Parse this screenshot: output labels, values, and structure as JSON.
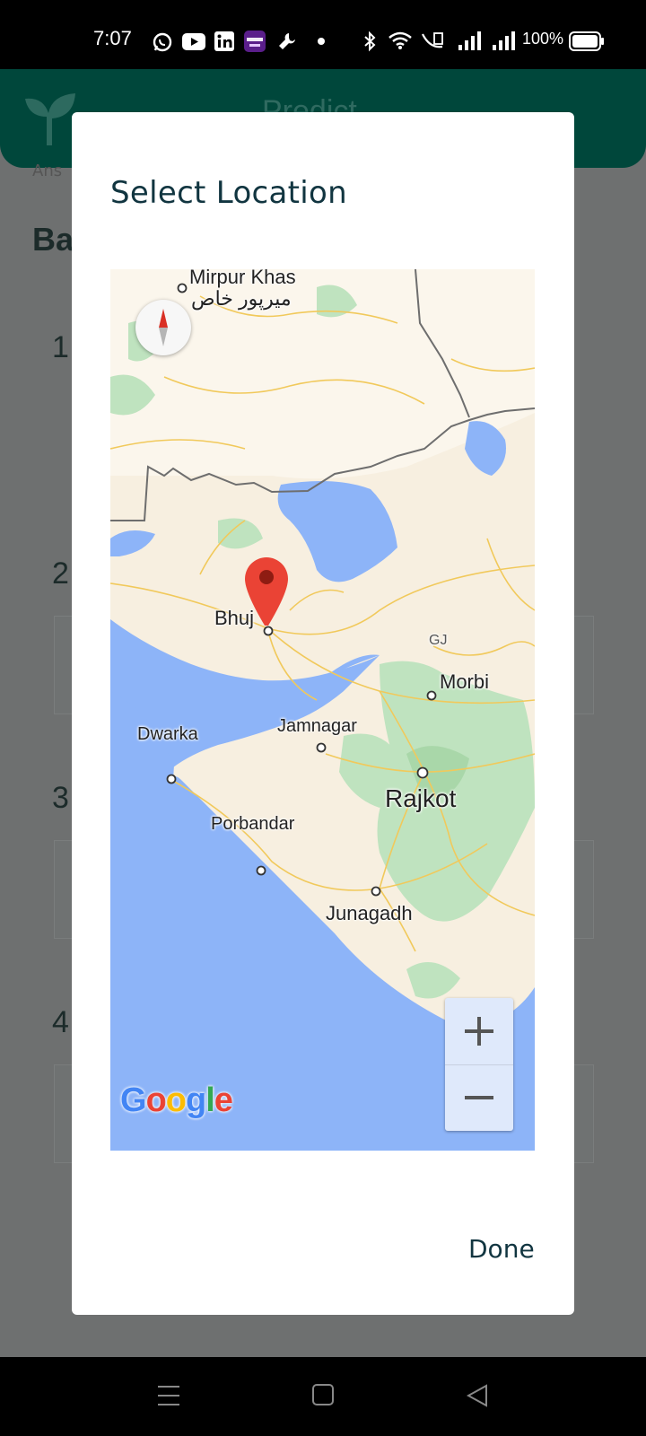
{
  "status_bar": {
    "time": "7:07",
    "battery_percent": "100%"
  },
  "background_app": {
    "title": "Predict",
    "section_title": "Ba",
    "small_text": "Ans",
    "list_numbers": [
      "1",
      "2",
      "3",
      "4"
    ]
  },
  "dialog": {
    "title": "Select Location",
    "done_label": "Done"
  },
  "map": {
    "labels": {
      "mirpur_khas": "Mirpur Khas",
      "mirpur_khas_urdu": "میرپور خاص",
      "bhuj": "Bhuj",
      "gj": "GJ",
      "morbi": "Morbi",
      "dwarka": "Dwarka",
      "jamnagar": "Jamnagar",
      "rajkot": "Rajkot",
      "porbandar": "Porbandar",
      "junagadh": "Junagadh"
    },
    "google_logo": {
      "letters": [
        "G",
        "o",
        "o",
        "g",
        "l",
        "e"
      ],
      "colors": [
        "#4285F4",
        "#EA4335",
        "#FBBC05",
        "#4285F4",
        "#34A853",
        "#EA4335"
      ]
    },
    "zoom_in_icon": "plus-icon",
    "zoom_out_icon": "minus-icon",
    "marker_color": "#EA4335"
  }
}
